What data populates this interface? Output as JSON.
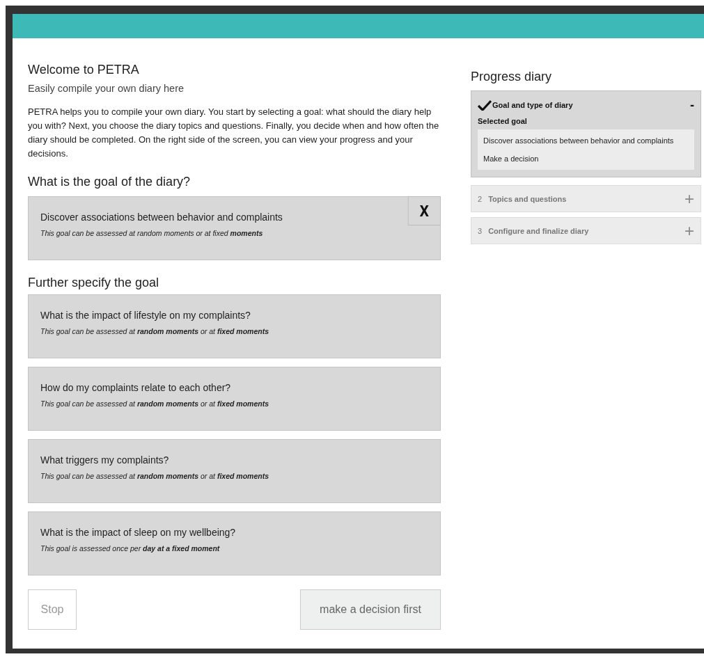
{
  "intro": {
    "title": "Welcome to PETRA",
    "subtitle": "Easily compile your own diary here",
    "text": "PETRA helps you to compile your own diary. You start by selecting a goal: what should the diary help you with? Next, you choose the diary topics and questions. Finally, you decide when and how often the diary should be completed. On the right side of the screen, you can view your progress and your decisions."
  },
  "goal_section": {
    "heading": "What is the goal of the diary?",
    "goals": [
      {
        "title": "Discover associations between behavior and complaints",
        "note": "This goal can be assessed at random moments or at fixed **moments**",
        "remove_label": "X"
      }
    ]
  },
  "specify_section": {
    "heading": "Further specify the goal",
    "goals": [
      {
        "title": "What is the impact of lifestyle on my complaints?",
        "note": "This goal can be assessed at **random moments** or at **fixed moments**"
      },
      {
        "title": "How do my complaints relate to each other?",
        "note": "This goal can be assessed at **random moments** or at **fixed moments**"
      },
      {
        "title": "What triggers my complaints?",
        "note": "This goal can be assessed at **random moments** or at **fixed moments**"
      },
      {
        "title": "What is the impact of sleep on my wellbeing?",
        "note": "This goal is assessed once per **day at a fixed moment**"
      }
    ]
  },
  "buttons": [
    {
      "label": "Stop",
      "kind": "secondary",
      "disabled": true
    },
    {
      "label": "make a decision first",
      "kind": "primary",
      "disabled": true
    }
  ],
  "progress": {
    "title": "Progress diary",
    "steps": [
      {
        "title": "Goal and type of diary",
        "completed": true,
        "expanded": true,
        "toggle": "-",
        "detail_label": "Selected goal",
        "detail_items": [
          "Discover associations between behavior and complaints",
          "Make a decision"
        ]
      },
      {
        "number": "2",
        "title": "Topics and questions",
        "completed": false,
        "expanded": false,
        "toggle": "+"
      },
      {
        "number": "3",
        "title": "Configure and finalize diary",
        "completed": false,
        "expanded": false,
        "toggle": "+"
      }
    ]
  }
}
